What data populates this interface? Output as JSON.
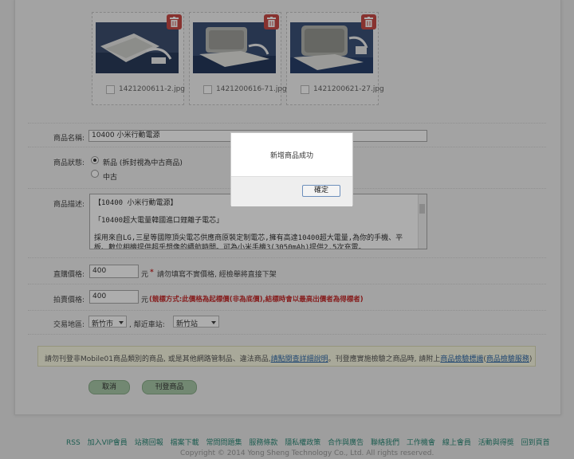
{
  "images": [
    {
      "filename": "1421200611-2.jpg"
    },
    {
      "filename": "1421200616-71.jpg"
    },
    {
      "filename": "1421200621-27.jpg"
    }
  ],
  "form": {
    "name_label": "商品名稱:",
    "name_value": "10400 小米行動電源",
    "status_label": "商品狀態:",
    "status_new": "新品 (拆封視為中古商品)",
    "status_used": "中古",
    "desc_label": "商品描述:",
    "desc_lines": [
      "【10400 小米行動電源】",
      "「10400超大電量韓國進口鋰離子電芯」",
      "採用來自LG,三星等國際頂尖電芯供應商原裝定制電芯,擁有高達10400超大電量,為你的手機、平",
      "板、數位相機提供超乎想像的續航時間。可為小米手機3(3050mAh)提供2.5次充電。"
    ],
    "direct_price_label": "直購價格:",
    "direct_price_value": "400",
    "direct_price_unit": "元",
    "direct_price_star": "*",
    "direct_price_note": "請勿填寫不實價格, 經檢舉將直接下架",
    "auction_price_label": "拍賣價格:",
    "auction_price_value": "400",
    "auction_price_unit": "元",
    "auction_price_note": "(競標方式:此價格為起標價(非為底價),結標時會以最高出價者為得標者)",
    "area_label": "交易地區:",
    "city_value": "新竹市",
    "station_label": ", 鄰近車站:",
    "station_value": "新竹站"
  },
  "notice": {
    "text_a": "請勿刊登非Mobile01商品類別的商品, 或是其他網路管制品、違法商品,",
    "link_a": "請點閱查詳細說明",
    "text_b": "。刊登應實施檢驗之商品時, 請附上",
    "link_b": "商品檢驗標識",
    "text_c": "(",
    "link_c": "商品檢驗服務",
    "text_d": ")"
  },
  "buttons": {
    "cancel": "取消",
    "publish": "刊登商品"
  },
  "footer": {
    "links": [
      "RSS",
      "加入VIP會員",
      "站務回報",
      "檔案下載",
      "常問問題集",
      "服務條款",
      "隱私權政策",
      "合作與廣告",
      "聯絡我們",
      "工作機會",
      "線上會員",
      "活動與得獎",
      "回到頁首"
    ],
    "copyright": "Copyright © 2014 Yong Sheng Technology Co., Ltd. All rights reserved."
  },
  "dialog": {
    "message": "新增商品成功",
    "ok": "確定"
  },
  "colors": {
    "delete_button": "#c94b46",
    "accent_red": "#c62d2d",
    "footer_link": "#2d8a78",
    "notice_bg": "#fafae3"
  }
}
